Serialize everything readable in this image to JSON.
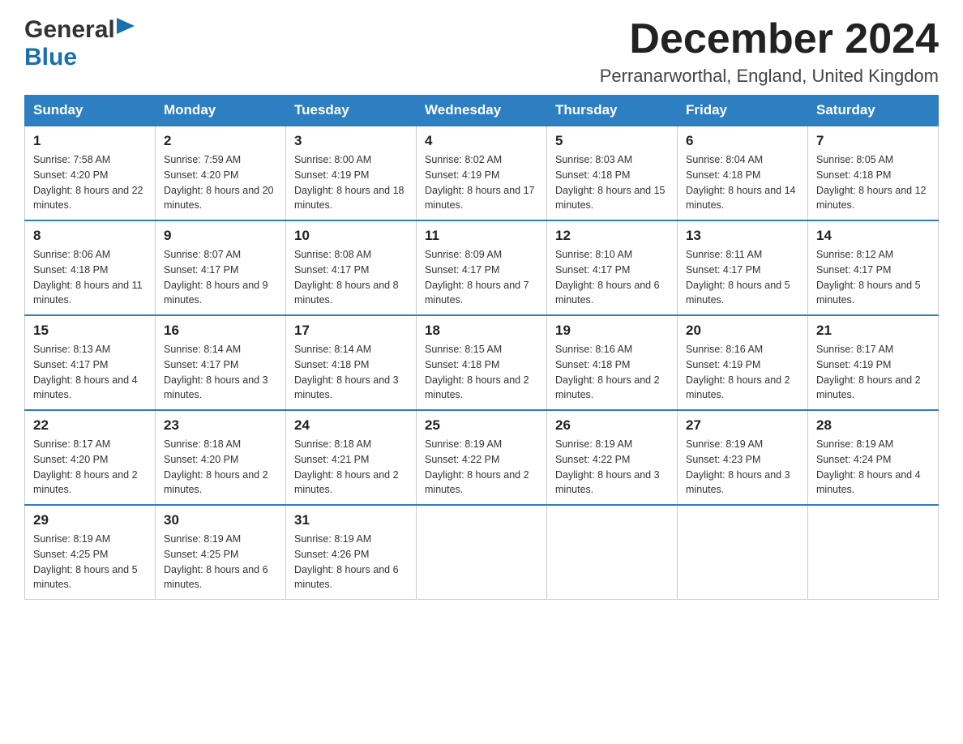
{
  "header": {
    "logo_general": "General",
    "logo_blue": "Blue",
    "month_title": "December 2024",
    "location": "Perranarworthal, England, United Kingdom"
  },
  "calendar": {
    "days_of_week": [
      "Sunday",
      "Monday",
      "Tuesday",
      "Wednesday",
      "Thursday",
      "Friday",
      "Saturday"
    ],
    "weeks": [
      [
        {
          "day": "1",
          "sunrise": "Sunrise: 7:58 AM",
          "sunset": "Sunset: 4:20 PM",
          "daylight": "Daylight: 8 hours and 22 minutes."
        },
        {
          "day": "2",
          "sunrise": "Sunrise: 7:59 AM",
          "sunset": "Sunset: 4:20 PM",
          "daylight": "Daylight: 8 hours and 20 minutes."
        },
        {
          "day": "3",
          "sunrise": "Sunrise: 8:00 AM",
          "sunset": "Sunset: 4:19 PM",
          "daylight": "Daylight: 8 hours and 18 minutes."
        },
        {
          "day": "4",
          "sunrise": "Sunrise: 8:02 AM",
          "sunset": "Sunset: 4:19 PM",
          "daylight": "Daylight: 8 hours and 17 minutes."
        },
        {
          "day": "5",
          "sunrise": "Sunrise: 8:03 AM",
          "sunset": "Sunset: 4:18 PM",
          "daylight": "Daylight: 8 hours and 15 minutes."
        },
        {
          "day": "6",
          "sunrise": "Sunrise: 8:04 AM",
          "sunset": "Sunset: 4:18 PM",
          "daylight": "Daylight: 8 hours and 14 minutes."
        },
        {
          "day": "7",
          "sunrise": "Sunrise: 8:05 AM",
          "sunset": "Sunset: 4:18 PM",
          "daylight": "Daylight: 8 hours and 12 minutes."
        }
      ],
      [
        {
          "day": "8",
          "sunrise": "Sunrise: 8:06 AM",
          "sunset": "Sunset: 4:18 PM",
          "daylight": "Daylight: 8 hours and 11 minutes."
        },
        {
          "day": "9",
          "sunrise": "Sunrise: 8:07 AM",
          "sunset": "Sunset: 4:17 PM",
          "daylight": "Daylight: 8 hours and 9 minutes."
        },
        {
          "day": "10",
          "sunrise": "Sunrise: 8:08 AM",
          "sunset": "Sunset: 4:17 PM",
          "daylight": "Daylight: 8 hours and 8 minutes."
        },
        {
          "day": "11",
          "sunrise": "Sunrise: 8:09 AM",
          "sunset": "Sunset: 4:17 PM",
          "daylight": "Daylight: 8 hours and 7 minutes."
        },
        {
          "day": "12",
          "sunrise": "Sunrise: 8:10 AM",
          "sunset": "Sunset: 4:17 PM",
          "daylight": "Daylight: 8 hours and 6 minutes."
        },
        {
          "day": "13",
          "sunrise": "Sunrise: 8:11 AM",
          "sunset": "Sunset: 4:17 PM",
          "daylight": "Daylight: 8 hours and 5 minutes."
        },
        {
          "day": "14",
          "sunrise": "Sunrise: 8:12 AM",
          "sunset": "Sunset: 4:17 PM",
          "daylight": "Daylight: 8 hours and 5 minutes."
        }
      ],
      [
        {
          "day": "15",
          "sunrise": "Sunrise: 8:13 AM",
          "sunset": "Sunset: 4:17 PM",
          "daylight": "Daylight: 8 hours and 4 minutes."
        },
        {
          "day": "16",
          "sunrise": "Sunrise: 8:14 AM",
          "sunset": "Sunset: 4:17 PM",
          "daylight": "Daylight: 8 hours and 3 minutes."
        },
        {
          "day": "17",
          "sunrise": "Sunrise: 8:14 AM",
          "sunset": "Sunset: 4:18 PM",
          "daylight": "Daylight: 8 hours and 3 minutes."
        },
        {
          "day": "18",
          "sunrise": "Sunrise: 8:15 AM",
          "sunset": "Sunset: 4:18 PM",
          "daylight": "Daylight: 8 hours and 2 minutes."
        },
        {
          "day": "19",
          "sunrise": "Sunrise: 8:16 AM",
          "sunset": "Sunset: 4:18 PM",
          "daylight": "Daylight: 8 hours and 2 minutes."
        },
        {
          "day": "20",
          "sunrise": "Sunrise: 8:16 AM",
          "sunset": "Sunset: 4:19 PM",
          "daylight": "Daylight: 8 hours and 2 minutes."
        },
        {
          "day": "21",
          "sunrise": "Sunrise: 8:17 AM",
          "sunset": "Sunset: 4:19 PM",
          "daylight": "Daylight: 8 hours and 2 minutes."
        }
      ],
      [
        {
          "day": "22",
          "sunrise": "Sunrise: 8:17 AM",
          "sunset": "Sunset: 4:20 PM",
          "daylight": "Daylight: 8 hours and 2 minutes."
        },
        {
          "day": "23",
          "sunrise": "Sunrise: 8:18 AM",
          "sunset": "Sunset: 4:20 PM",
          "daylight": "Daylight: 8 hours and 2 minutes."
        },
        {
          "day": "24",
          "sunrise": "Sunrise: 8:18 AM",
          "sunset": "Sunset: 4:21 PM",
          "daylight": "Daylight: 8 hours and 2 minutes."
        },
        {
          "day": "25",
          "sunrise": "Sunrise: 8:19 AM",
          "sunset": "Sunset: 4:22 PM",
          "daylight": "Daylight: 8 hours and 2 minutes."
        },
        {
          "day": "26",
          "sunrise": "Sunrise: 8:19 AM",
          "sunset": "Sunset: 4:22 PM",
          "daylight": "Daylight: 8 hours and 3 minutes."
        },
        {
          "day": "27",
          "sunrise": "Sunrise: 8:19 AM",
          "sunset": "Sunset: 4:23 PM",
          "daylight": "Daylight: 8 hours and 3 minutes."
        },
        {
          "day": "28",
          "sunrise": "Sunrise: 8:19 AM",
          "sunset": "Sunset: 4:24 PM",
          "daylight": "Daylight: 8 hours and 4 minutes."
        }
      ],
      [
        {
          "day": "29",
          "sunrise": "Sunrise: 8:19 AM",
          "sunset": "Sunset: 4:25 PM",
          "daylight": "Daylight: 8 hours and 5 minutes."
        },
        {
          "day": "30",
          "sunrise": "Sunrise: 8:19 AM",
          "sunset": "Sunset: 4:25 PM",
          "daylight": "Daylight: 8 hours and 6 minutes."
        },
        {
          "day": "31",
          "sunrise": "Sunrise: 8:19 AM",
          "sunset": "Sunset: 4:26 PM",
          "daylight": "Daylight: 8 hours and 6 minutes."
        },
        null,
        null,
        null,
        null
      ]
    ]
  }
}
